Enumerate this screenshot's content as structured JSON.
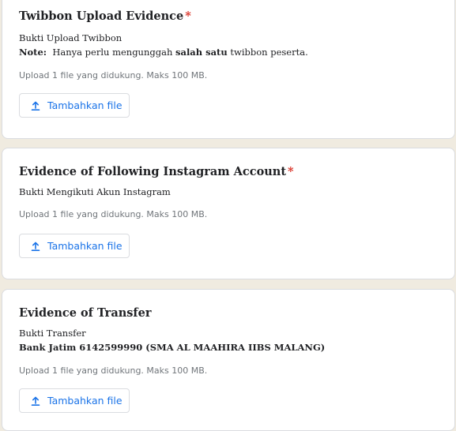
{
  "questions": [
    {
      "title": "Twibbon Upload Evidence",
      "required_mark": "*",
      "description_line1": "Bukti Upload Twibbon",
      "note": {
        "label": "Note:",
        "text_before": "Hanya perlu mengunggah",
        "bold": "salah satu",
        "text_after": "twibbon peserta."
      },
      "upload_info": "Upload 1 file yang didukung. Maks 100 MB.",
      "upload_button_label": "Tambahkan file"
    },
    {
      "title": "Evidence of Following Instagram Account",
      "required_mark": "*",
      "description_line1": "Bukti Mengikuti Akun Instagram",
      "upload_info": "Upload 1 file yang didukung. Maks 100 MB.",
      "upload_button_label": "Tambahkan file"
    },
    {
      "title": "Evidence of Transfer",
      "description_line1": "Bukti Transfer",
      "description_line2_bold": "Bank Jatim 6142599990 (SMA AL MAAHIRA IIBS MALANG)",
      "upload_info": "Upload 1 file yang didukung. Maks 100 MB.",
      "upload_button_label": "Tambahkan file"
    }
  ],
  "icons": {
    "upload": "upload-icon"
  },
  "colors": {
    "background": "#f0ebe0",
    "required": "#d93025",
    "accent": "#1a73e8",
    "muted": "#70757a"
  }
}
